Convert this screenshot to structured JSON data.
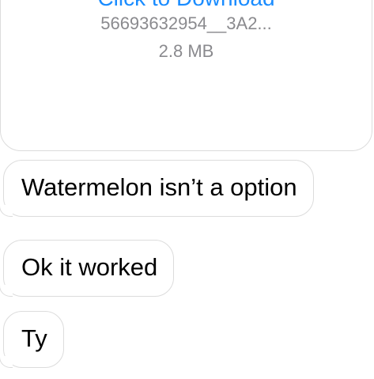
{
  "attachment": {
    "link_label": "Click to Download",
    "file_name": "56693632954__3A2...",
    "file_size": "2.8 MB"
  },
  "messages": [
    {
      "text": "Watermelon isn’t a option"
    },
    {
      "text": "Ok it worked"
    },
    {
      "text": "Ty"
    }
  ]
}
